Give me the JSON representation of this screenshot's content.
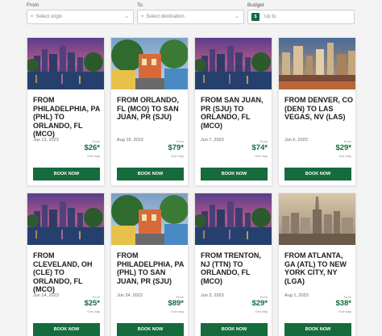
{
  "filters": {
    "from_label": "From",
    "to_label": "To",
    "budget_label": "Budget",
    "origin_placeholder": "Select origin",
    "destination_placeholder": "Select destination",
    "budget_badge": "$",
    "budget_placeholder": "Up to"
  },
  "cards": [
    {
      "title": "FROM PHILADELPHIA, PA (PHL) TO ORLANDO, FL (MCO)",
      "date": "Jun 13, 2023",
      "from": "From",
      "price": "$26*",
      "oneway": "One way",
      "button": "BOOK NOW",
      "image": "orlando"
    },
    {
      "title": "FROM ORLANDO, FL (MCO) TO SAN JUAN, PR (SJU)",
      "date": "Aug 19, 2023",
      "from": "From",
      "price": "$79*",
      "oneway": "One way",
      "button": "BOOK NOW",
      "image": "sanjuan"
    },
    {
      "title": "FROM SAN JUAN, PR (SJU) TO ORLANDO, FL (MCO)",
      "date": "Jun 7, 2023",
      "from": "From",
      "price": "$74*",
      "oneway": "One way",
      "button": "BOOK NOW",
      "image": "orlando"
    },
    {
      "title": "FROM DENVER, CO (DEN) TO LAS VEGAS, NV (LAS)",
      "date": "Jun 6, 2023",
      "from": "From",
      "price": "$29*",
      "oneway": "One way",
      "button": "BOOK NOW",
      "image": "vegas"
    },
    {
      "title": "FROM CLEVELAND, OH (CLE) TO ORLANDO, FL (MCO)",
      "date": "Jun 14, 2023",
      "from": "From",
      "price": "$25*",
      "oneway": "One way",
      "button": "BOOK NOW",
      "image": "orlando"
    },
    {
      "title": "FROM PHILADELPHIA, PA (PHL) TO SAN JUAN, PR (SJU)",
      "date": "Jun 24, 2023",
      "from": "From",
      "price": "$89*",
      "oneway": "One way",
      "button": "BOOK NOW",
      "image": "sanjuan"
    },
    {
      "title": "FROM TRENTON, NJ (TTN) TO ORLANDO, FL (MCO)",
      "date": "Jun 3, 2023",
      "from": "From",
      "price": "$29*",
      "oneway": "One way",
      "button": "BOOK NOW",
      "image": "orlando"
    },
    {
      "title": "FROM ATLANTA, GA (ATL) TO NEW YORK CITY, NY (LGA)",
      "date": "Aug 1, 2023",
      "from": "From",
      "price": "$38*",
      "oneway": "One way",
      "button": "BOOK NOW",
      "image": "nyc"
    }
  ],
  "colors": {
    "accent": "#166b3d",
    "background": "#f3f3f3"
  },
  "icons": {
    "filter_field": "chevron-down-icon",
    "origin": "location-icon",
    "destination": "location-icon"
  }
}
